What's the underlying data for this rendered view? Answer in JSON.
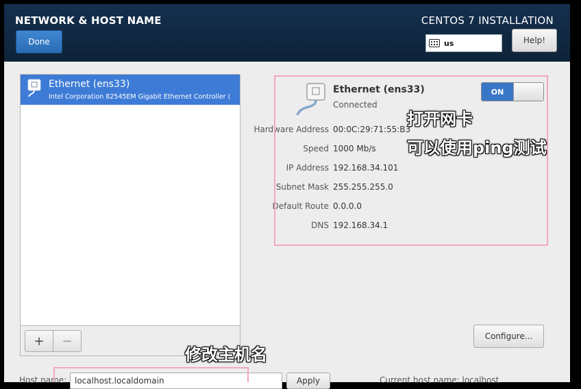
{
  "header": {
    "title": "NETWORK & HOST NAME",
    "product": "CENTOS 7 INSTALLATION",
    "done_label": "Done",
    "keyboard_layout": "us",
    "help_label": "Help!"
  },
  "device_list": {
    "items": [
      {
        "name": "Ethernet (ens33)",
        "description": "Intel Corporation 82545EM Gigabit Ethernet Controller (",
        "selected": true
      }
    ],
    "add_label": "+",
    "remove_label": "−"
  },
  "details": {
    "name": "Ethernet (ens33)",
    "status": "Connected",
    "toggle_label": "ON",
    "toggle_state": "on",
    "properties": [
      {
        "label": "Hardware Address",
        "value": "00:0C:29:71:55:B3"
      },
      {
        "label": "Speed",
        "value": "1000 Mb/s"
      },
      {
        "label": "IP Address",
        "value": "192.168.34.101"
      },
      {
        "label": "Subnet Mask",
        "value": "255.255.255.0"
      },
      {
        "label": "Default Route",
        "value": "0.0.0.0"
      },
      {
        "label": "DNS",
        "value": "192.168.34.1"
      }
    ],
    "configure_label": "Configure..."
  },
  "annotations": {
    "line1": "打开网卡",
    "line2": "可以使用ping测试",
    "hostname_note": "修改主机名"
  },
  "hostname": {
    "label": "Host name:",
    "value": "localhost.localdomain",
    "apply_label": "Apply",
    "current": "Current host name: localhost"
  },
  "colors": {
    "header_bg": "#14304f",
    "accent": "#3d7bd6",
    "annotation_box": "#f3a6c4"
  }
}
